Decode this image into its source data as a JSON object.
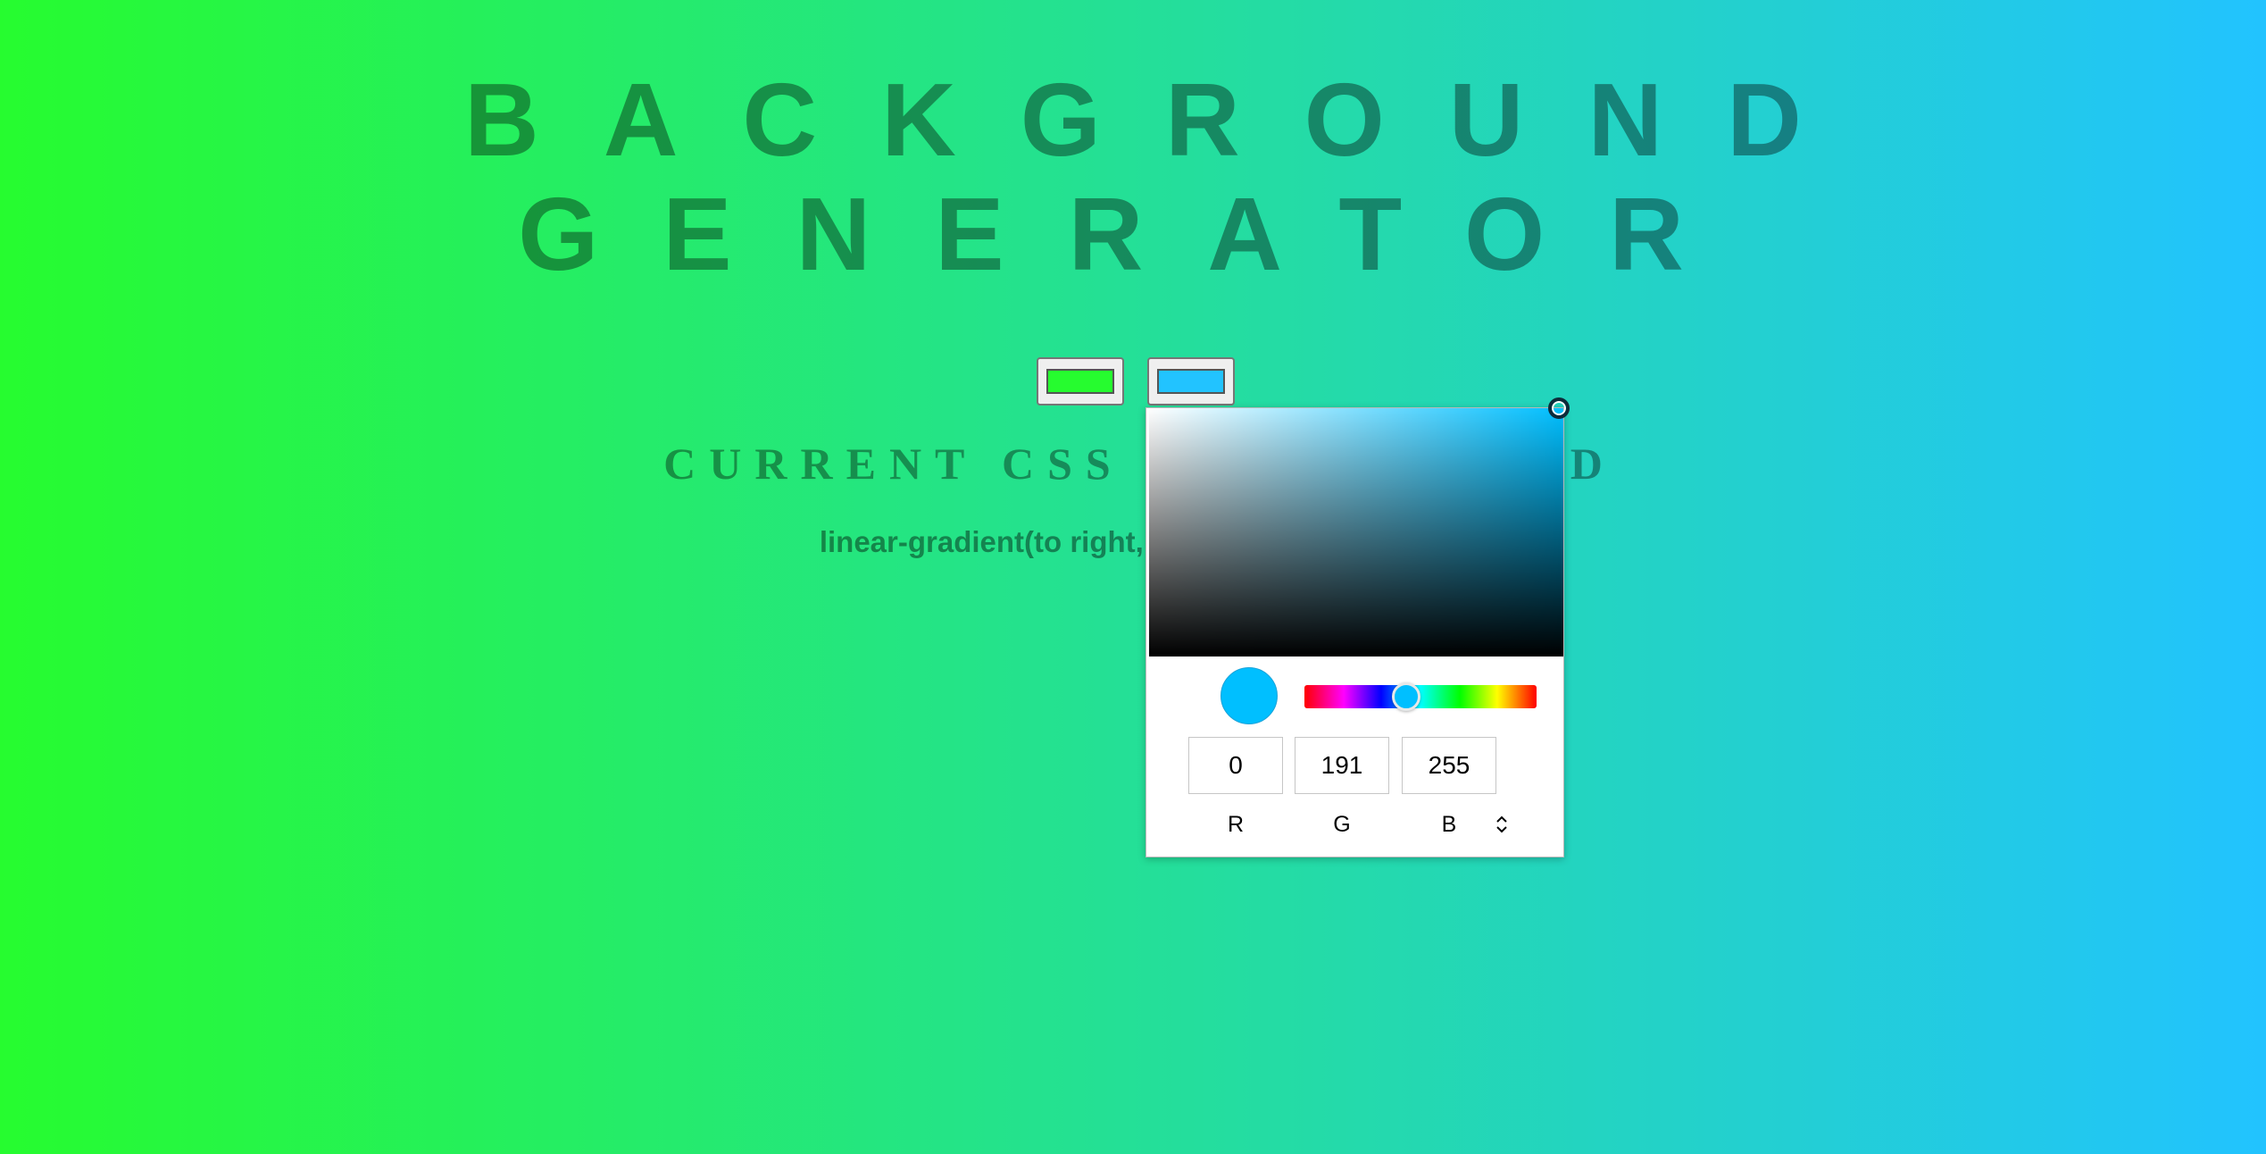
{
  "title": {
    "line1": "BACKGROUND",
    "line2": "GENERATOR"
  },
  "inputs": {
    "color1": "#26fc2f",
    "color2": "#22c3ff"
  },
  "subtitle": {
    "visible_left": "CURRENT CSS",
    "visible_right": "D"
  },
  "css_output": {
    "visible_text": "linear-gradient(to right, rgb("
  },
  "picker": {
    "current_color": "#00bfff",
    "hue_color": "#00bfff",
    "hue_position_percent": 44,
    "r": "0",
    "g": "191",
    "b": "255",
    "label_r": "R",
    "label_g": "G",
    "label_b": "B",
    "mode_toggle_icon": "up-down-chevron-icon"
  },
  "colors": {
    "gradient_start": "#26fc2f",
    "gradient_end": "#22c3ff",
    "title_color": "rgba(0,0,0,0.38)"
  }
}
